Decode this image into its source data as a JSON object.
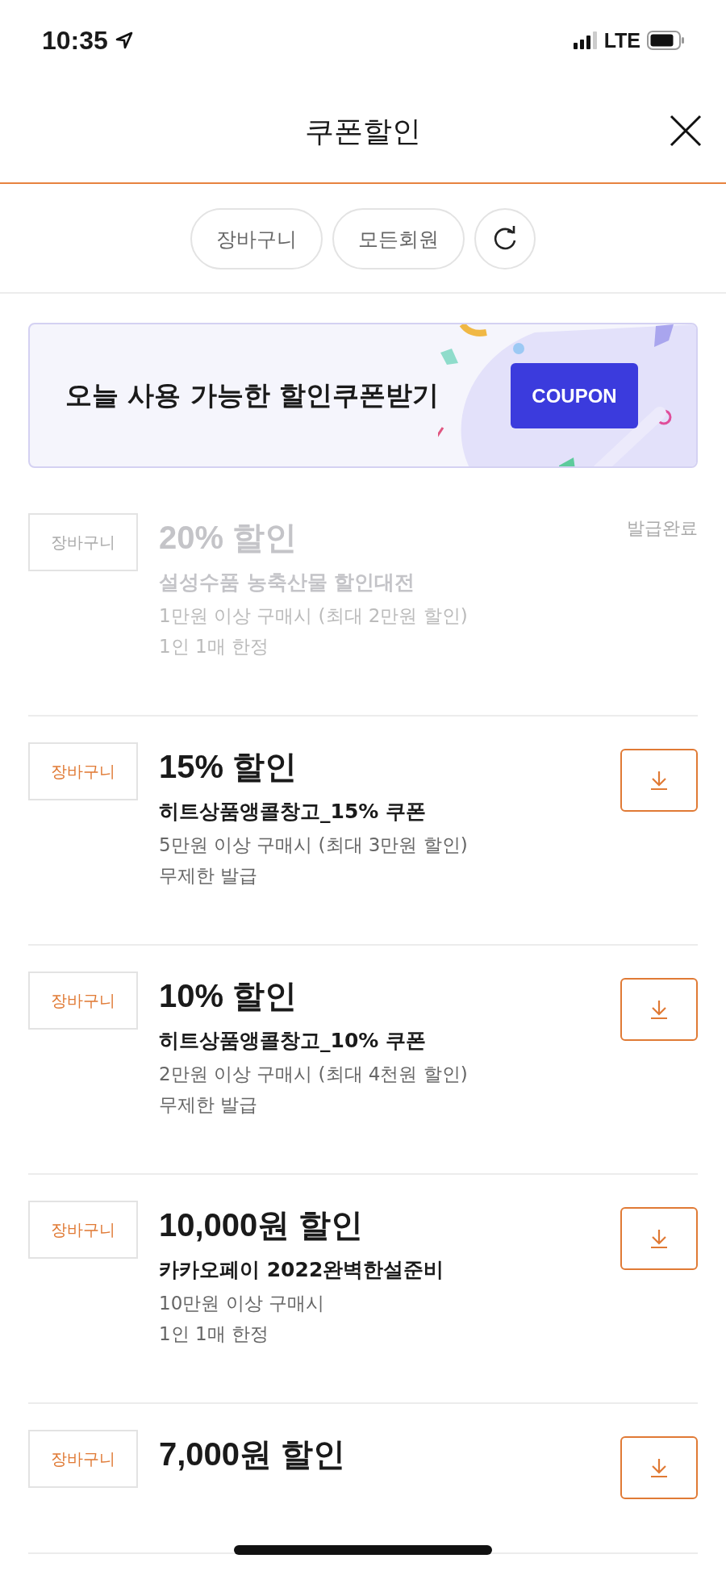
{
  "status_bar": {
    "time": "10:35",
    "network": "LTE"
  },
  "header": {
    "title": "쿠폰할인"
  },
  "filters": [
    {
      "label": "장바구니"
    },
    {
      "label": "모든회원"
    }
  ],
  "banner": {
    "text": "오늘 사용 가능한 할인쿠폰받기",
    "button": "COUPON"
  },
  "coupons": [
    {
      "tag": "장바구니",
      "discount": "20% 할인",
      "name": "설성수품 농축산물 할인대전",
      "details": [
        "1만원 이상 구매시 (최대 2만원 할인)",
        "1인 1매 한정"
      ],
      "issued": true,
      "status": "발급완료"
    },
    {
      "tag": "장바구니",
      "discount": "15% 할인",
      "name": "히트상품앵콜창고_15% 쿠폰",
      "details": [
        "5만원 이상 구매시 (최대 3만원 할인)",
        "무제한 발급"
      ],
      "issued": false
    },
    {
      "tag": "장바구니",
      "discount": "10% 할인",
      "name": "히트상품앵콜창고_10% 쿠폰",
      "details": [
        "2만원 이상 구매시 (최대 4천원 할인)",
        "무제한 발급"
      ],
      "issued": false
    },
    {
      "tag": "장바구니",
      "discount": "10,000원 할인",
      "name": "카카오페이 2022완벽한설준비",
      "details": [
        "10만원 이상 구매시",
        "1인 1매 한정"
      ],
      "issued": false
    },
    {
      "tag": "장바구니",
      "discount": "7,000원 할인",
      "issued": false
    }
  ]
}
